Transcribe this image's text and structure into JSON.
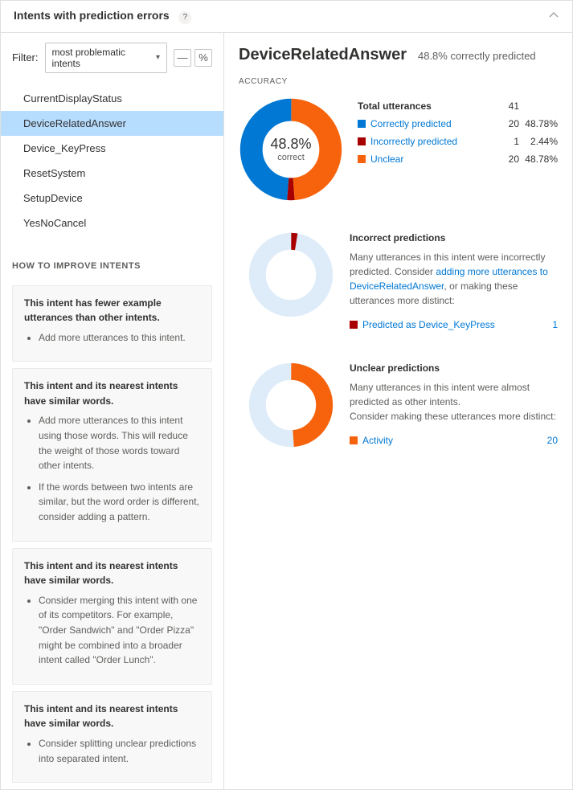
{
  "header": {
    "title": "Intents with prediction errors",
    "help": "?"
  },
  "filter": {
    "label": "Filter:",
    "selected": "most problematic intents",
    "dash_btn": "—",
    "pct_btn": "%"
  },
  "intents": [
    {
      "name": "CurrentDisplayStatus",
      "selected": false
    },
    {
      "name": "DeviceRelatedAnswer",
      "selected": true
    },
    {
      "name": "Device_KeyPress",
      "selected": false
    },
    {
      "name": "ResetSystem",
      "selected": false
    },
    {
      "name": "SetupDevice",
      "selected": false
    },
    {
      "name": "YesNoCancel",
      "selected": false
    }
  ],
  "improve": {
    "title": "HOW TO IMPROVE INTENTS",
    "cards": [
      {
        "heading": "This intent has fewer example utterances than other intents.",
        "bullets": [
          "Add more utterances to this intent."
        ]
      },
      {
        "heading": "This intent and its nearest intents have similar words.",
        "bullets": [
          "Add more utterances to this intent using those words. This will reduce the weight of those words toward other intents.",
          "If the words between two intents are similar, but the word order is different, consider adding a pattern."
        ]
      },
      {
        "heading": "This intent and its nearest intents have similar words.",
        "bullets": [
          "Consider merging this intent with one of its competitors. For example, \"Order Sandwich\" and \"Order Pizza\" might be combined into a broader intent called \"Order Lunch\"."
        ]
      },
      {
        "heading": "This intent and its nearest intents have similar words.",
        "bullets": [
          "Consider splitting unclear predictions into separated intent."
        ]
      }
    ]
  },
  "detail": {
    "name": "DeviceRelatedAnswer",
    "sub": "48.8% correctly predicted",
    "accuracy_label": "ACCURACY",
    "center_pct": "48.8%",
    "center_word": "correct",
    "total_label": "Total utterances",
    "total_n": "41",
    "legend": [
      {
        "color": "#0078d4",
        "label": "Correctly predicted",
        "n": "20",
        "pct": "48.78%"
      },
      {
        "color": "#a80000",
        "label": "Incorrectly predicted",
        "n": "1",
        "pct": "2.44%"
      },
      {
        "color": "#f7630c",
        "label": "Unclear",
        "n": "20",
        "pct": "48.78%"
      }
    ],
    "incorrect": {
      "title": "Incorrect predictions",
      "text1": "Many utterances in this intent were incorrectly predicted. Consider ",
      "link": "adding more utterances to DeviceRelatedAnswer",
      "text2": ", or making these utterances more distinct:",
      "rows": [
        {
          "color": "#a80000",
          "label": "Predicted as Device_KeyPress",
          "n": "1"
        }
      ]
    },
    "unclear": {
      "title": "Unclear predictions",
      "text": "Many utterances in this intent were almost predicted as other intents.\nConsider making these utterances more distinct:",
      "rows": [
        {
          "color": "#f7630c",
          "label": "Activity",
          "n": "20"
        }
      ]
    }
  },
  "chart_data": {
    "type": "pie",
    "title": "Accuracy — DeviceRelatedAnswer",
    "series": [
      {
        "name": "Correctly predicted",
        "value": 20,
        "pct": 48.78,
        "color": "#0078d4"
      },
      {
        "name": "Incorrectly predicted",
        "value": 1,
        "pct": 2.44,
        "color": "#a80000"
      },
      {
        "name": "Unclear",
        "value": 20,
        "pct": 48.78,
        "color": "#f7630c"
      }
    ],
    "total": 41,
    "sub_charts": [
      {
        "type": "pie",
        "title": "Incorrect predictions",
        "series": [
          {
            "name": "Predicted as Device_KeyPress",
            "value": 1,
            "color": "#a80000"
          },
          {
            "name": "Other",
            "value": 40,
            "color": "#deecf9"
          }
        ]
      },
      {
        "type": "pie",
        "title": "Unclear predictions",
        "series": [
          {
            "name": "Activity",
            "value": 20,
            "color": "#f7630c"
          },
          {
            "name": "Other",
            "value": 21,
            "color": "#deecf9"
          }
        ]
      }
    ]
  }
}
